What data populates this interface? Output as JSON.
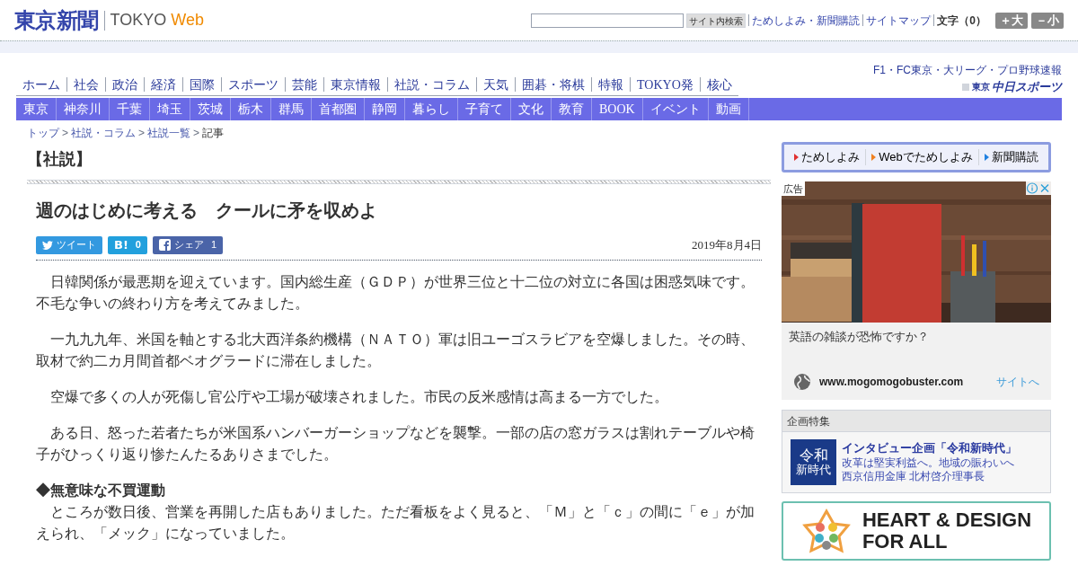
{
  "header": {
    "logo": "東京新聞",
    "brand_a": "TOKYO",
    "brand_b": "Web",
    "search_button": "サイト内検索",
    "links": [
      "ためしよみ・新聞購読",
      "サイトマップ"
    ],
    "font_label": "文字（0）",
    "font_buttons": [
      "＋大",
      "－小"
    ]
  },
  "nav_main": [
    "ホーム",
    "社会",
    "政治",
    "経済",
    "国際",
    "スポーツ",
    "芸能",
    "東京情報",
    "社説・コラム",
    "天気",
    "囲碁・将棋",
    "特報",
    "TOKYO発",
    "核心"
  ],
  "sports_banner": {
    "line1": "F1・FC東京・大リーグ・プロ野球速報",
    "line2a": "東京",
    "line2b": "中日スポーツ"
  },
  "nav_sub": [
    "東京",
    "神奈川",
    "千葉",
    "埼玉",
    "茨城",
    "栃木",
    "群馬",
    "首都圏",
    "静岡",
    "暮らし",
    "子育て",
    "文化",
    "教育",
    "BOOK",
    "イベント",
    "動画"
  ],
  "breadcrumb_separator": ">",
  "breadcrumb": [
    {
      "label": "トップ",
      "link": true
    },
    {
      "label": "社説・コラム",
      "link": true
    },
    {
      "label": "社説一覧",
      "link": true
    },
    {
      "label": "記事",
      "link": false
    }
  ],
  "section": "【社説】",
  "article": {
    "title": "週のはじめに考える　クールに矛を収めよ",
    "share": [
      {
        "kind": "twitter",
        "label": "ツイート"
      },
      {
        "kind": "hatena",
        "label": "B!",
        "count": "0"
      },
      {
        "kind": "facebook",
        "label": "シェア",
        "count": "1"
      }
    ],
    "date": "2019年8月4日",
    "body": [
      {
        "kind": "p",
        "text": "日韓関係が最悪期を迎えています。国内総生産（ＧＤＰ）が世界三位と十二位の対立に各国は困惑気味です。不毛な争いの終わり方を考えてみました。"
      },
      {
        "kind": "p",
        "text": "一九九九年、米国を軸とする北大西洋条約機構（ＮＡＴＯ）軍は旧ユーゴスラビアを空爆しました。その時、取材で約二カ月間首都ベオグラードに滞在しました。"
      },
      {
        "kind": "p",
        "text": "空爆で多くの人が死傷し官公庁や工場が破壊されました。市民の反米感情は高まる一方でした。"
      },
      {
        "kind": "p",
        "text": "ある日、怒った若者たちが米国系ハンバーガーショップなどを襲撃。一部の店の窓ガラスは割れテーブルや椅子がひっくり返り惨たんたるありさまでした。"
      },
      {
        "kind": "heading",
        "text": "◆無意味な不買運動"
      },
      {
        "kind": "p",
        "text": "ところが数日後、営業を再開した店もありました。ただ看板をよく見ると、「Ｍ」と「ｃ」の間に「ｅ」が加えられ、「メック」になっていました。"
      }
    ]
  },
  "sidebar": {
    "trial_links": [
      {
        "label": "ためしよみ",
        "color": "#e03030"
      },
      {
        "label": "Webでためしよみ",
        "color": "#f08020"
      },
      {
        "label": "新聞購読",
        "color": "#2080e0"
      }
    ],
    "ad": {
      "badge": "広告",
      "headline": "英語の雑談が恐怖ですか？",
      "url": "www.mogomogobuster.com",
      "cta": "サイトへ"
    },
    "feature": {
      "heading": "企画特集",
      "thumb_a": "令和",
      "thumb_b": "新時代",
      "title": "インタビュー企画「令和新時代」",
      "lines": [
        "改革は堅実利益へ。地域の賑わいへ",
        "西京信用金庫 北村啓介理事長"
      ]
    },
    "banner": {
      "line1": "HEART & DESIGN",
      "line2": "FOR ALL"
    }
  }
}
